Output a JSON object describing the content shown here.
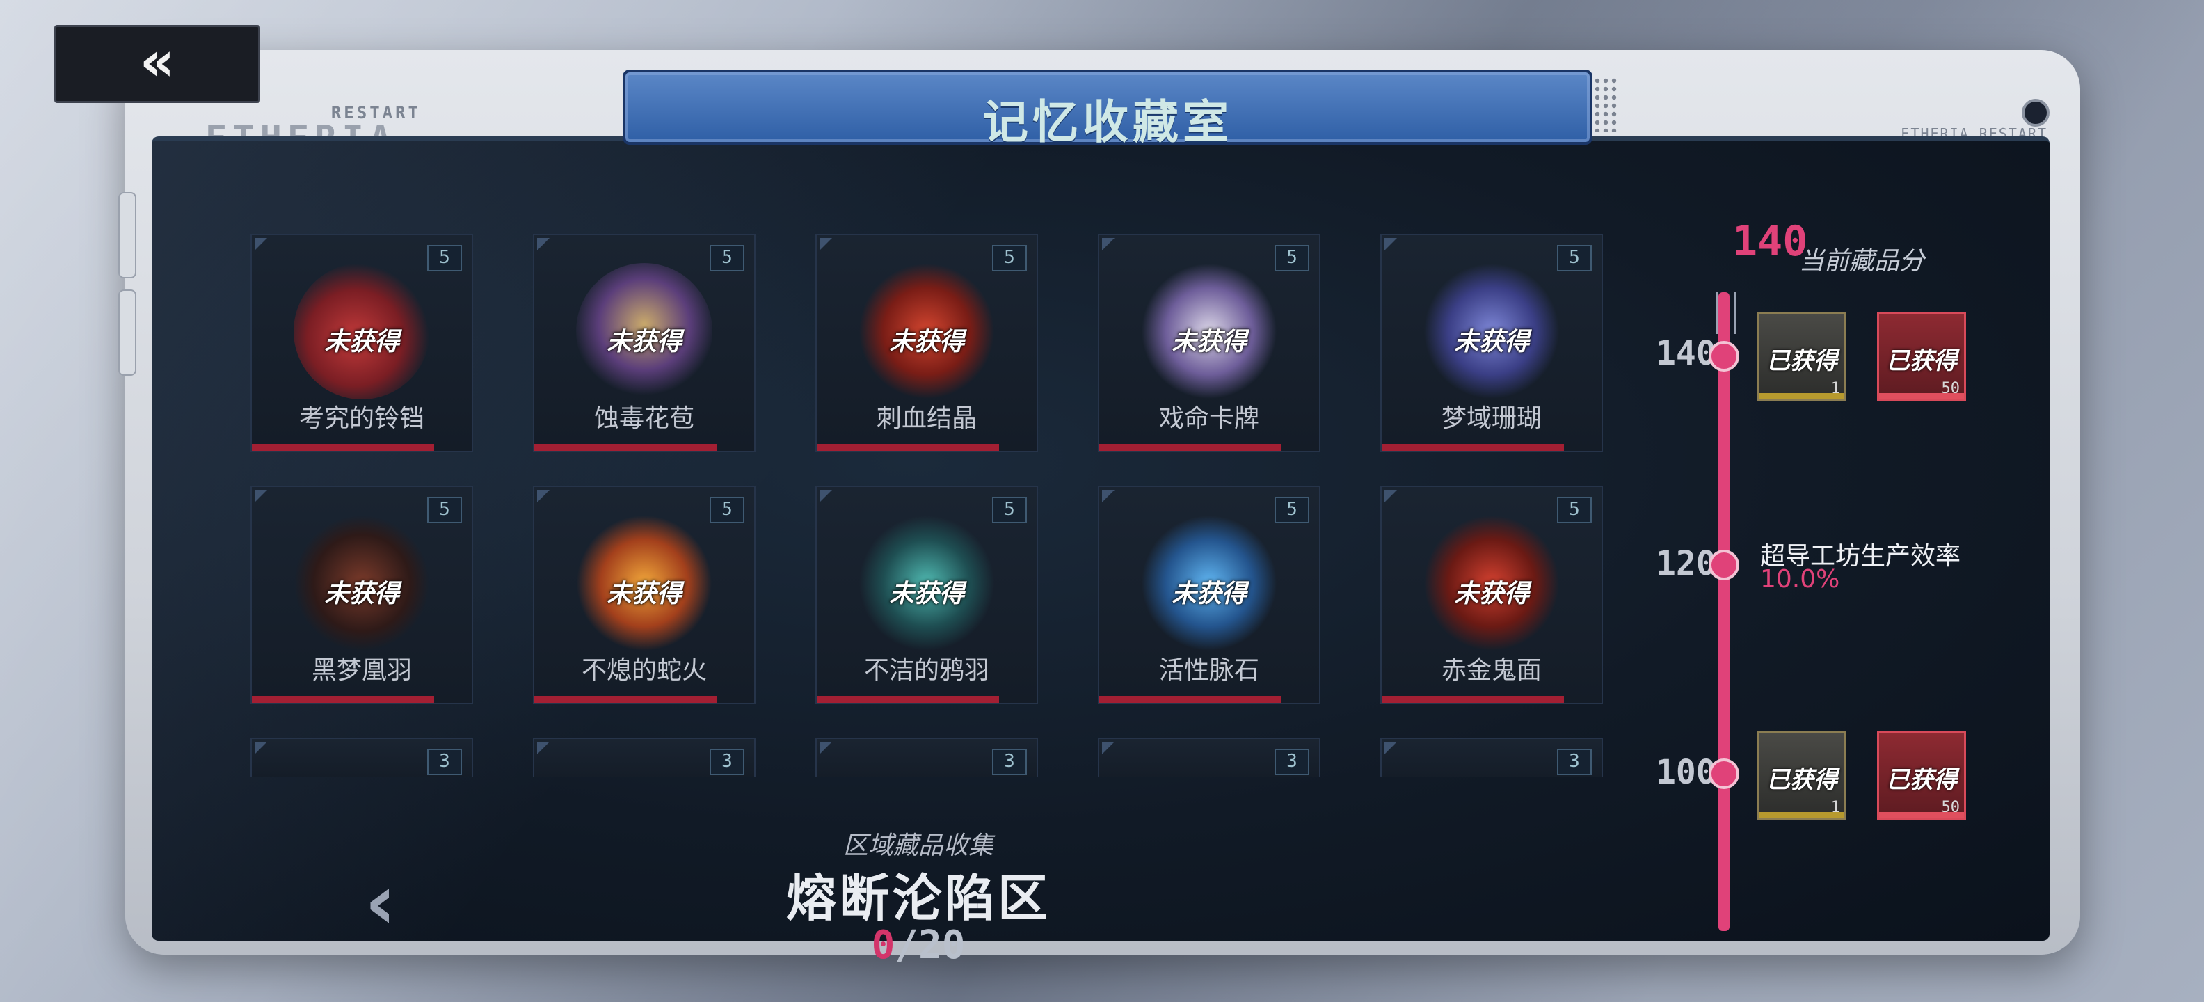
{
  "header": {
    "back_icon": "double-chevron-left-icon",
    "title": "记忆收藏室"
  },
  "device": {
    "brand_small": "RESTART",
    "brand_big": "ETHERIA",
    "brand_right": "ETHERIA RESTART"
  },
  "collection": {
    "rows": [
      [
        {
          "name": "考究的铃铛",
          "status": "未获得",
          "points": "5"
        },
        {
          "name": "蚀毒花苞",
          "status": "未获得",
          "points": "5"
        },
        {
          "name": "刺血结晶",
          "status": "未获得",
          "points": "5"
        },
        {
          "name": "戏命卡牌",
          "status": "未获得",
          "points": "5"
        },
        {
          "name": "梦域珊瑚",
          "status": "未获得",
          "points": "5"
        }
      ],
      [
        {
          "name": "黑梦凰羽",
          "status": "未获得",
          "points": "5"
        },
        {
          "name": "不熄的蛇火",
          "status": "未获得",
          "points": "5"
        },
        {
          "name": "不洁的鸦羽",
          "status": "未获得",
          "points": "5"
        },
        {
          "name": "活性脉石",
          "status": "未获得",
          "points": "5"
        },
        {
          "name": "赤金鬼面",
          "status": "未获得",
          "points": "5"
        }
      ],
      [
        {
          "points": "3"
        },
        {
          "points": "3"
        },
        {
          "points": "3"
        },
        {
          "points": "3"
        },
        {
          "points": "3"
        }
      ]
    ]
  },
  "region": {
    "subtitle": "区域藏品收集",
    "name": "熔断沦陷区",
    "collected": "0",
    "total": "/20",
    "prev_icon": "chevron-left-icon"
  },
  "score": {
    "value": "140",
    "label": "当前藏品分"
  },
  "milestones": [
    {
      "level": "140",
      "rewards": [
        {
          "status": "已获得",
          "qty": "1",
          "style": "gold"
        },
        {
          "status": "已获得",
          "qty": "50",
          "style": "red"
        }
      ]
    },
    {
      "level": "120",
      "buff_title": "超导工坊生产效率",
      "buff_value": "10.0%"
    },
    {
      "level": "100",
      "rewards": [
        {
          "status": "已获得",
          "qty": "1",
          "style": "gold"
        },
        {
          "status": "已获得",
          "qty": "50",
          "style": "red"
        }
      ]
    }
  ],
  "colors": {
    "accent_pink": "#e04279",
    "card_bar_red": "#a31f33",
    "title_blue": "#2f5fa6"
  }
}
